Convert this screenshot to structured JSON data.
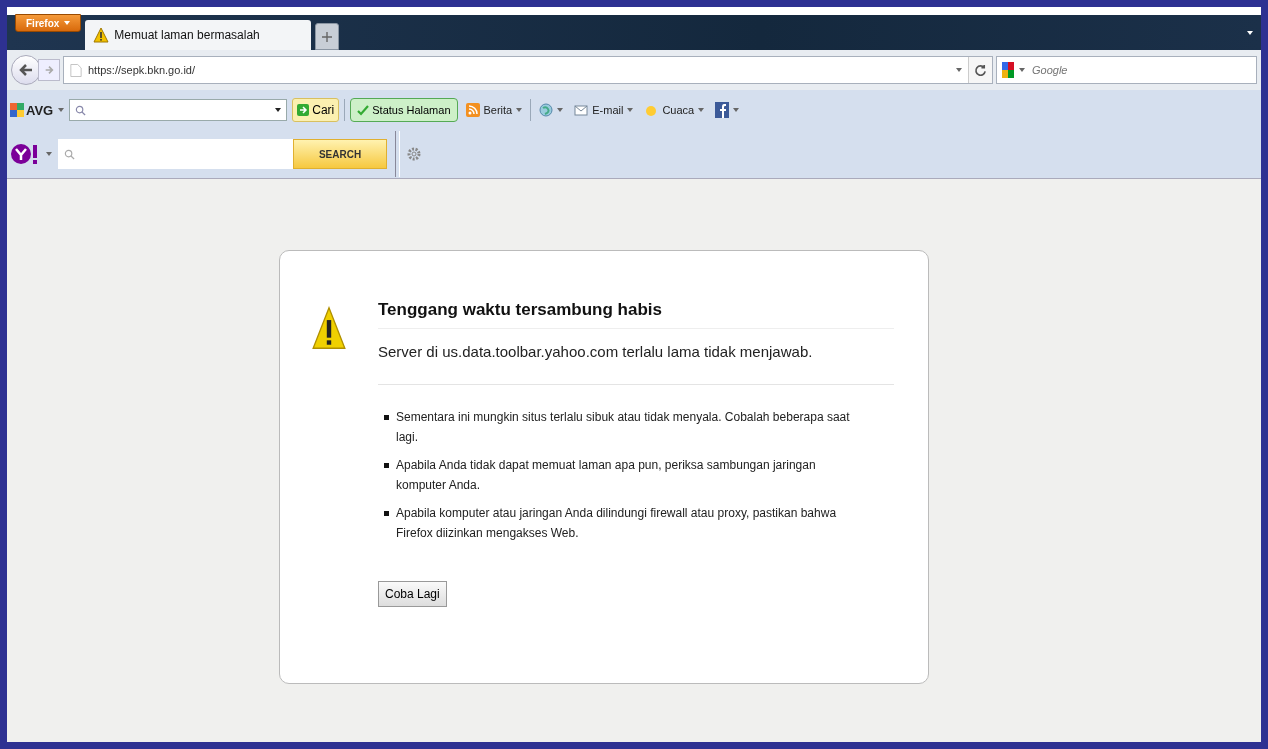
{
  "browser": {
    "menu_button": "Firefox",
    "tabs": [
      {
        "title": "Memuat laman bermasalah",
        "selected": true
      }
    ],
    "url": "https://sepk.bkn.go.id/",
    "search_placeholder": "Google"
  },
  "avg_toolbar": {
    "brand": "AVG",
    "search_button": "Cari",
    "items": [
      {
        "kind": "status",
        "label": "Status Halaman"
      },
      {
        "kind": "feed",
        "label": "Berita"
      },
      {
        "kind": "globe"
      },
      {
        "kind": "mail",
        "label": "E-mail"
      },
      {
        "kind": "weather",
        "label": "Cuaca"
      },
      {
        "kind": "facebook"
      }
    ]
  },
  "yahoo_toolbar": {
    "search_button": "SEARCH"
  },
  "error": {
    "title": "Tenggang waktu tersambung habis",
    "message": "Server di us.data.toolbar.yahoo.com terlalu lama tidak menjawab.",
    "bullets": [
      "Sementara ini mungkin situs terlalu sibuk atau tidak menyala. Cobalah beberapa saat lagi.",
      "Apabila Anda tidak dapat memuat laman apa pun, periksa sambungan jaringan komputer Anda.",
      "Apabila komputer atau jaringan Anda dilindungi firewall atau proxy, pastikan bahwa Firefox diizinkan mengakses Web."
    ],
    "button": "Coba Lagi"
  }
}
